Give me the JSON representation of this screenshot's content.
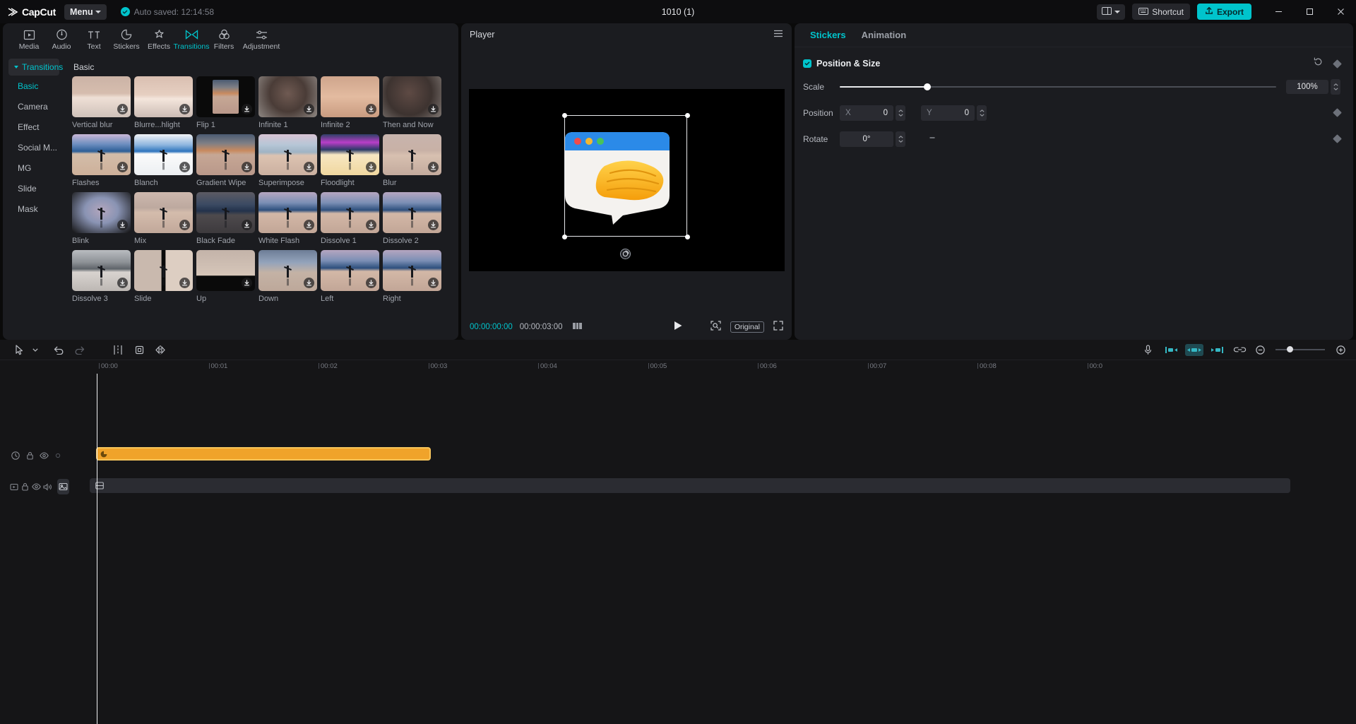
{
  "titlebar": {
    "brand": "CapCut",
    "menu_label": "Menu",
    "autosave_text": "Auto saved: 12:14:58",
    "project_title": "1010 (1)",
    "shortcut_label": "Shortcut",
    "export_label": "Export",
    "icons": {
      "layout": "layout-icon",
      "layout_caret": "chevron-down-icon",
      "shortcut": "keyboard-icon",
      "export": "export-icon",
      "minimize": "minimize-icon",
      "maximize": "maximize-icon",
      "close": "close-icon"
    }
  },
  "left_panel": {
    "tabs": [
      {
        "label": "Media",
        "icon": "media-icon",
        "active": false
      },
      {
        "label": "Audio",
        "icon": "audio-icon",
        "active": false
      },
      {
        "label": "Text",
        "icon": "text-icon",
        "active": false
      },
      {
        "label": "Stickers",
        "icon": "sticker-icon",
        "active": false
      },
      {
        "label": "Effects",
        "icon": "effects-icon",
        "active": false
      },
      {
        "label": "Transitions",
        "icon": "transitions-icon",
        "active": true
      },
      {
        "label": "Filters",
        "icon": "filters-icon",
        "active": false
      },
      {
        "label": "Adjustment",
        "icon": "adjustment-icon",
        "active": false
      }
    ],
    "sidebar": {
      "group_label": "Transitions",
      "items": [
        {
          "label": "Basic",
          "active": true
        },
        {
          "label": "Camera",
          "active": false
        },
        {
          "label": "Effect",
          "active": false
        },
        {
          "label": "Social M...",
          "active": false
        },
        {
          "label": "MG",
          "active": false
        },
        {
          "label": "Slide",
          "active": false
        },
        {
          "label": "Mask",
          "active": false
        }
      ]
    },
    "section_title": "Basic",
    "transitions": [
      {
        "label": "Vertical blur",
        "style": "vblur"
      },
      {
        "label": "Blurre...hlight",
        "style": "sunset"
      },
      {
        "label": "Flip 1",
        "style": "flip"
      },
      {
        "label": "Infinite 1",
        "style": "portrait1"
      },
      {
        "label": "Infinite 2",
        "style": "portrait2"
      },
      {
        "label": "Then and Now",
        "style": "portrait3"
      },
      {
        "label": "Flashes",
        "style": "lake-blue"
      },
      {
        "label": "Blanch",
        "style": "lake-white"
      },
      {
        "label": "Gradient Wipe",
        "style": "lake-warm"
      },
      {
        "label": "Superimpose",
        "style": "lake-pale"
      },
      {
        "label": "Floodlight",
        "style": "lake-magenta"
      },
      {
        "label": "Blur",
        "style": "lake-soft"
      },
      {
        "label": "Blink",
        "style": "lake-vignette"
      },
      {
        "label": "Mix",
        "style": "lake-haze"
      },
      {
        "label": "Black Fade",
        "style": "lake-dark"
      },
      {
        "label": "White Flash",
        "style": "lake-std"
      },
      {
        "label": "Dissolve 1",
        "style": "lake-std"
      },
      {
        "label": "Dissolve 2",
        "style": "lake-std"
      },
      {
        "label": "Dissolve 3",
        "style": "lake-gray"
      },
      {
        "label": "Slide",
        "style": "split-v"
      },
      {
        "label": "Up",
        "style": "bar-bottom"
      },
      {
        "label": "Down",
        "style": "bar-top"
      },
      {
        "label": "Left",
        "style": "lake-std"
      },
      {
        "label": "Right",
        "style": "lake-std"
      }
    ],
    "download_icon": "download-icon"
  },
  "player": {
    "title": "Player",
    "menu_icon": "hamburger-icon",
    "current_time": "00:00:00:00",
    "total_time": "00:00:03:00",
    "frames_icon": "frames-icon",
    "play_icon": "play-icon",
    "fit_icon": "fit-screen-icon",
    "ratio_label": "Original",
    "fullscreen_icon": "fullscreen-icon",
    "rotate_handle_icon": "rotate-icon"
  },
  "right_panel": {
    "tabs": [
      {
        "label": "Stickers",
        "active": true
      },
      {
        "label": "Animation",
        "active": false
      }
    ],
    "section": {
      "title": "Position & Size",
      "checked": true,
      "reset_icon": "reset-icon",
      "keyframe_icon": "keyframe-icon"
    },
    "scale": {
      "label": "Scale",
      "value": "100%",
      "percent": 20
    },
    "position": {
      "label": "Position",
      "x_axis": "X",
      "x_value": "0",
      "y_axis": "Y",
      "y_value": "0"
    },
    "rotate": {
      "label": "Rotate",
      "value": "0°",
      "reset_icon": "minus-icon"
    }
  },
  "timeline": {
    "tools": [
      {
        "name": "select-tool",
        "icon": "cursor-icon"
      },
      {
        "name": "tool-dropdown",
        "icon": "chevron-down-icon"
      },
      {
        "name": "undo",
        "icon": "undo-icon"
      },
      {
        "name": "redo",
        "icon": "redo-icon"
      },
      {
        "name": "split",
        "icon": "split-icon"
      },
      {
        "name": "crop",
        "icon": "crop-icon"
      },
      {
        "name": "mirror",
        "icon": "mirror-icon"
      }
    ],
    "right_tools": [
      {
        "name": "record-voiceover",
        "icon": "microphone-icon"
      },
      {
        "name": "align-left",
        "icon": "align-left-icon",
        "active": false
      },
      {
        "name": "align-center",
        "icon": "align-center-icon",
        "active": true
      },
      {
        "name": "align-right",
        "icon": "align-right-icon",
        "active": false
      },
      {
        "name": "link-tracks",
        "icon": "link-icon",
        "active": false
      },
      {
        "name": "zoom-out",
        "icon": "zoom-out-icon"
      },
      {
        "name": "zoom-in",
        "icon": "zoom-in-icon"
      }
    ],
    "ruler_ticks": [
      "00:00",
      "00:01",
      "00:02",
      "00:03",
      "00:04",
      "00:05",
      "00:06",
      "00:07",
      "00:08",
      "00:0"
    ],
    "playhead_time": "00:00",
    "tracks": [
      {
        "name": "sticker-track",
        "controls": [
          "clock-icon",
          "lock-icon",
          "eye-icon",
          "dot-icon"
        ],
        "clip": {
          "type": "sticker",
          "icon": "sticker-clip-icon"
        }
      },
      {
        "name": "main-track",
        "controls": [
          "mute-track-icon",
          "lock-icon",
          "eye-icon",
          "volume-icon",
          "thumbnail-toggle-icon"
        ],
        "clip": {
          "type": "video",
          "icon": "video-clip-icon"
        }
      }
    ]
  }
}
